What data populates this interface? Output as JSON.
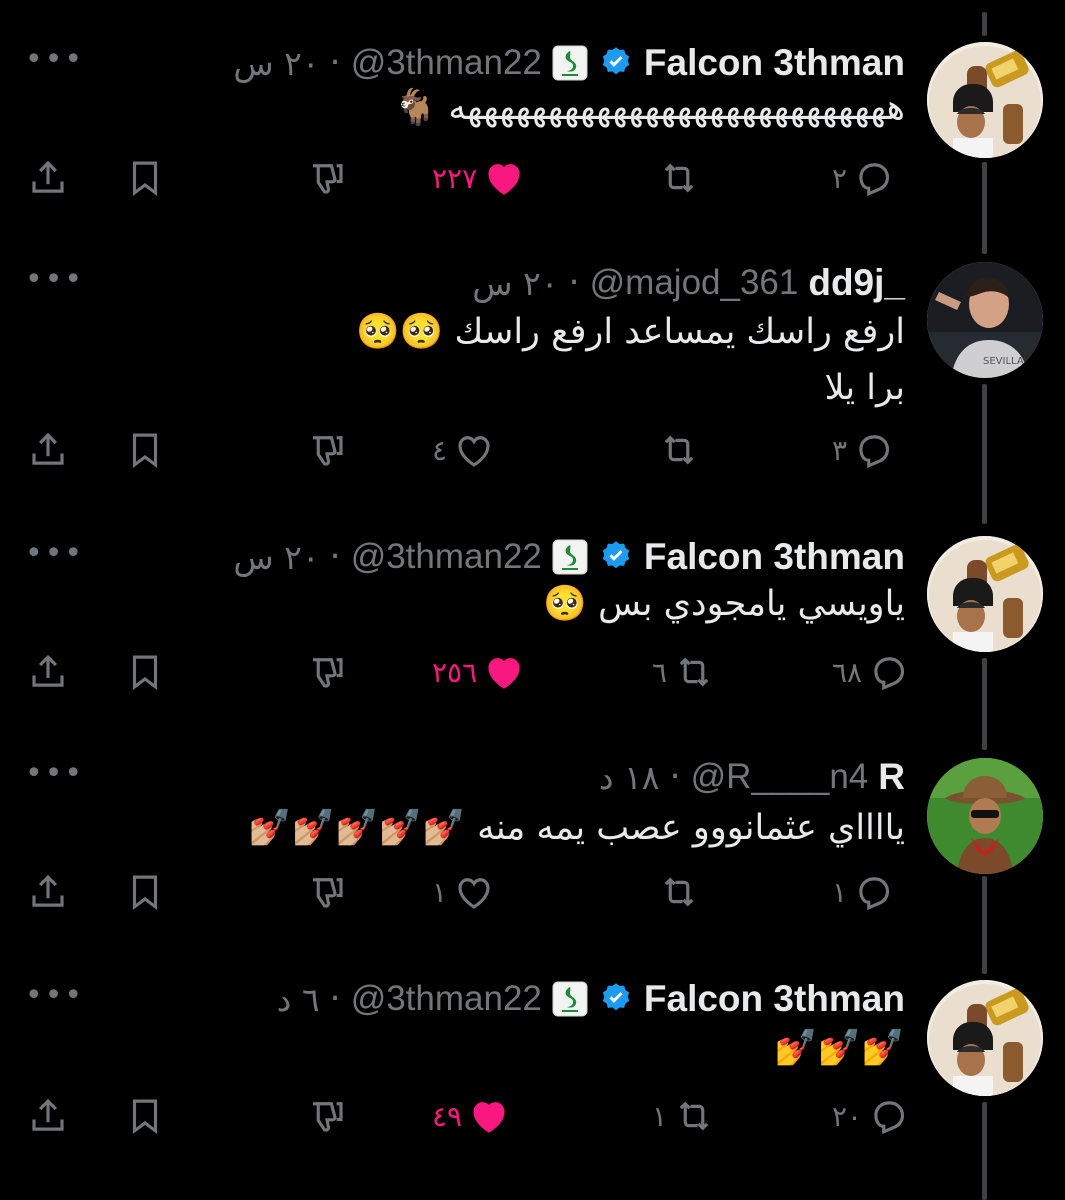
{
  "colors": {
    "background": "#000000",
    "text": "#e7e9ea",
    "muted": "#71767b",
    "like": "#f91880",
    "verified": "#1d9bf0",
    "thread_line": "#3e4144"
  },
  "more_label": "•••",
  "tweets": [
    {
      "author": "Falcon 3thman",
      "handle": "@3thman22",
      "time": "٢٠ س",
      "verified": true,
      "affiliate_badge": true,
      "text": "هههههههههههههههههههههههههههه 🐐",
      "replies": "٢",
      "retweets": "",
      "likes": "٢٢٧",
      "liked": true,
      "avatar_icon": "trophy-avatar"
    },
    {
      "author": "dd9j_",
      "handle": "@majod_361",
      "time": "٢٠ س",
      "verified": false,
      "affiliate_badge": false,
      "text": "ارفع راسك يمساعد ارفع راسك 🥺🥺\nبرا يلا",
      "replies": "٣",
      "retweets": "",
      "likes": "٤",
      "liked": false,
      "avatar_icon": "young-man-avatar"
    },
    {
      "author": "Falcon 3thman",
      "handle": "@3thman22",
      "time": "٢٠ س",
      "verified": true,
      "affiliate_badge": true,
      "text": "ياويسي يامجودي بس 🥺",
      "replies": "٦٨",
      "retweets": "٦",
      "likes": "٢٥٦",
      "liked": true,
      "avatar_icon": "trophy-avatar"
    },
    {
      "author": "R",
      "handle": "@R____n4",
      "time": "١٨ د",
      "verified": false,
      "affiliate_badge": false,
      "text": "يااااي عثمانووو عصب يمه منه 💅🏼💅🏼💅🏼💅🏼💅🏼",
      "replies": "١",
      "retweets": "",
      "likes": "١",
      "liked": false,
      "avatar_icon": "cowboy-avatar"
    },
    {
      "author": "Falcon 3thman",
      "handle": "@3thman22",
      "time": "٦ د",
      "verified": true,
      "affiliate_badge": true,
      "text": "💅💅💅",
      "replies": "٢٠",
      "retweets": "١",
      "likes": "٤٩",
      "liked": true,
      "avatar_icon": "trophy-avatar"
    }
  ]
}
